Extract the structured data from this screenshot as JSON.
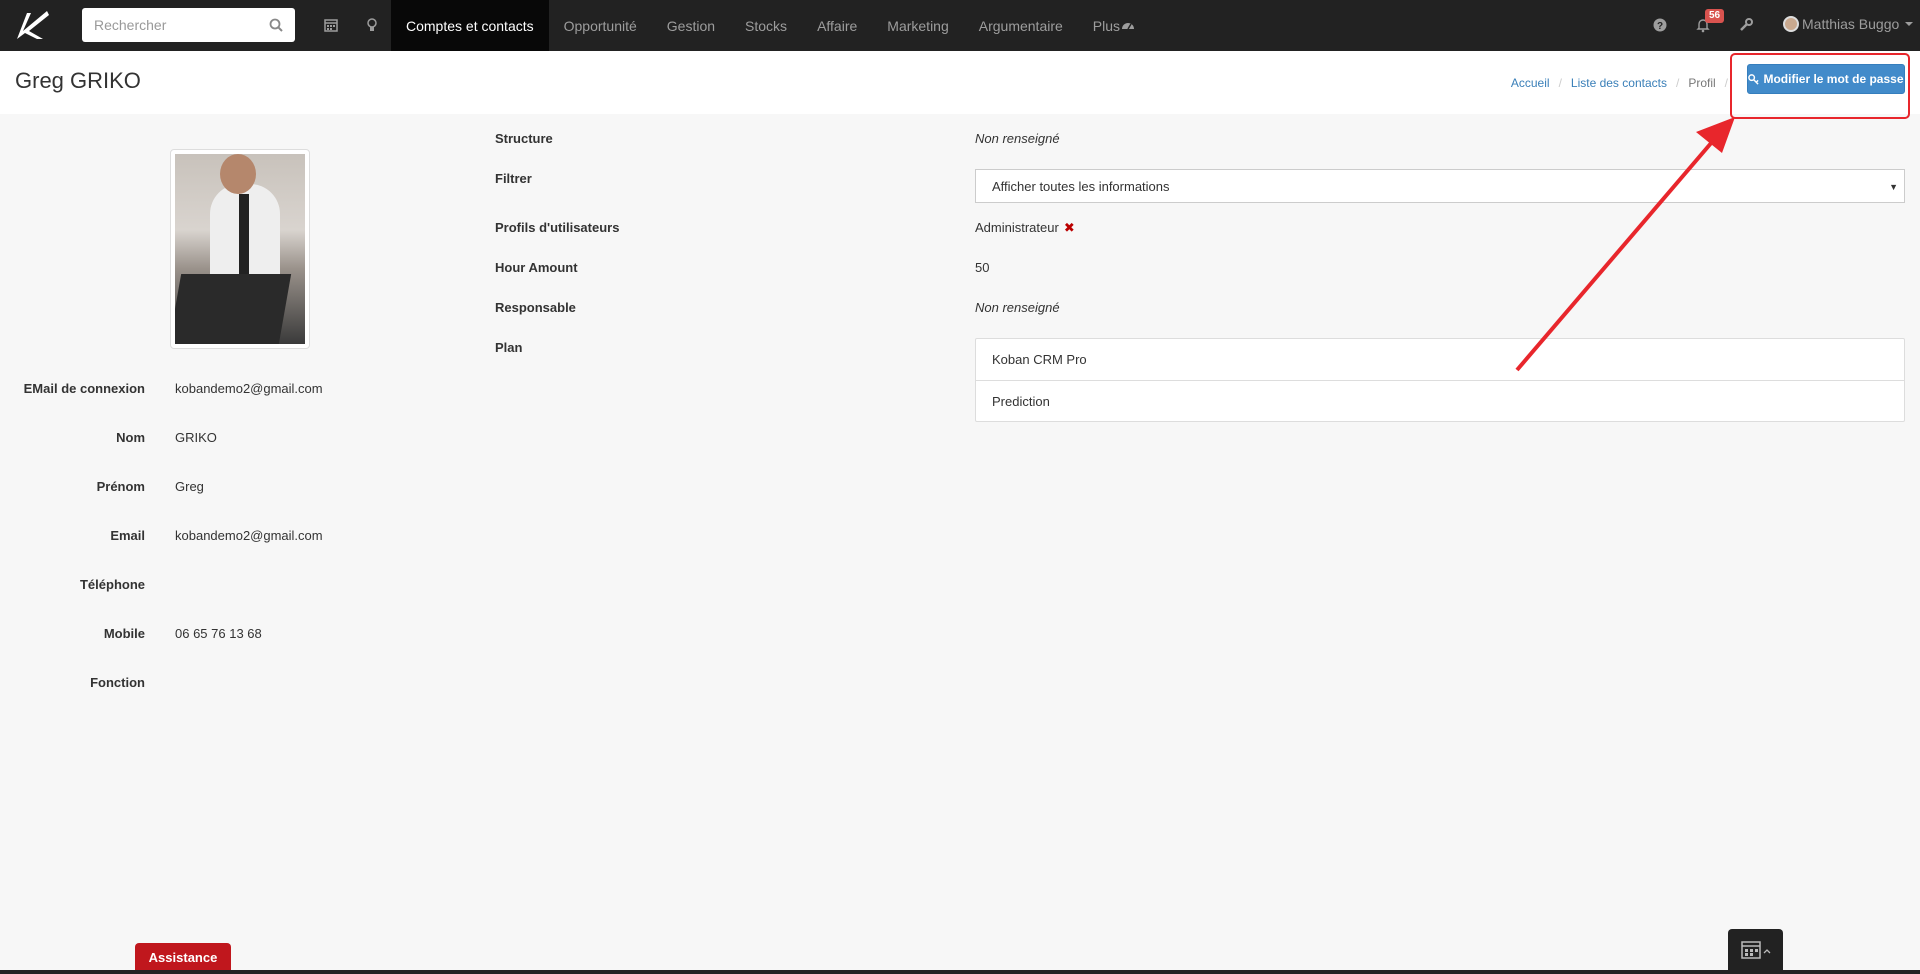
{
  "topbar": {
    "search_placeholder": "Rechercher",
    "nav_items": [
      "Comptes et contacts",
      "Opportunité",
      "Gestion",
      "Stocks",
      "Affaire",
      "Marketing",
      "Argumentaire",
      "Plus"
    ],
    "active_item": "Comptes et contacts",
    "notification_count": "56",
    "user_name": "Matthias Buggo"
  },
  "header": {
    "title": "Greg GRIKO",
    "breadcrumb": [
      "Accueil",
      "Liste des contacts",
      "Profil"
    ],
    "change_password_label": "Modifier le mot de passe"
  },
  "profile": {
    "fields": [
      {
        "label": "EMail de connexion",
        "value": "kobandemo2@gmail.com"
      },
      {
        "label": "Nom",
        "value": "GRIKO"
      },
      {
        "label": "Prénom",
        "value": "Greg"
      },
      {
        "label": "Email",
        "value": "kobandemo2@gmail.com"
      },
      {
        "label": "Téléphone",
        "value": ""
      },
      {
        "label": "Mobile",
        "value": "06 65 76 13 68"
      },
      {
        "label": "Fonction",
        "value": ""
      }
    ]
  },
  "details": {
    "structure_label": "Structure",
    "structure_value": "Non renseigné",
    "filter_label": "Filtrer",
    "filter_value": "Afficher toutes les informations",
    "profiles_label": "Profils d'utilisateurs",
    "profiles_value": "Administrateur",
    "hour_label": "Hour Amount",
    "hour_value": "50",
    "manager_label": "Responsable",
    "manager_value": "Non renseigné",
    "plan_label": "Plan",
    "plans": [
      "Koban CRM Pro",
      "Prediction"
    ]
  },
  "footer": {
    "assistance_label": "Assistance"
  },
  "colors": {
    "topbar": "#222222",
    "primary_button": "#428bca",
    "annotation": "#e8262c",
    "assistance": "#c0171d"
  }
}
